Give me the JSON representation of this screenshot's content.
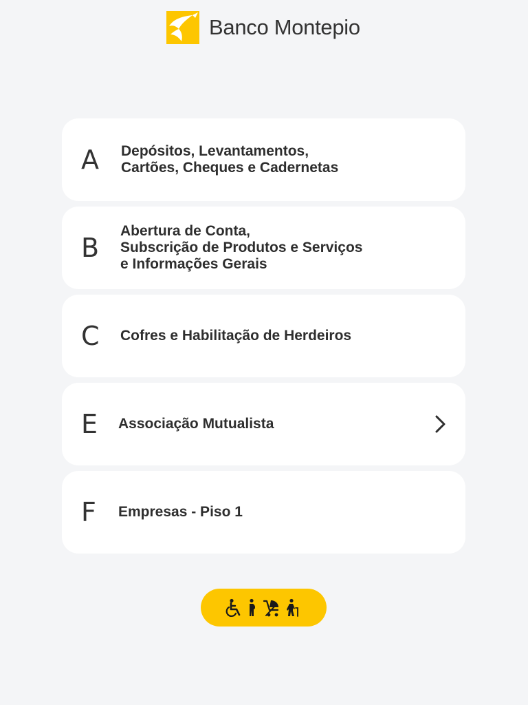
{
  "brand": {
    "name": "Banco Montepio",
    "colors": {
      "primary": "#fdc600",
      "text": "#2e2e2e",
      "background": "#f4f5f7",
      "card": "#ffffff"
    }
  },
  "queues": [
    {
      "letter": "A",
      "lines": [
        "Depósitos, Levantamentos,",
        "Cartões, Cheques e Cadernetas"
      ]
    },
    {
      "letter": "B",
      "lines": [
        "Abertura de Conta,",
        "Subscrição de Produtos e Serviços",
        "e Informações Gerais"
      ]
    },
    {
      "letter": "C",
      "lines": [
        "Cofres e Habilitação de Herdeiros"
      ]
    },
    {
      "letter": "E",
      "lines": [
        "Associação Mutualista"
      ],
      "icon": "chevron-right-icon"
    },
    {
      "letter": "F",
      "lines": [
        "Empresas - Piso 1"
      ]
    }
  ],
  "priority_button": {
    "icons": [
      "wheelchair-icon",
      "pregnant-person-icon",
      "stroller-icon",
      "elderly-person-icon"
    ]
  }
}
